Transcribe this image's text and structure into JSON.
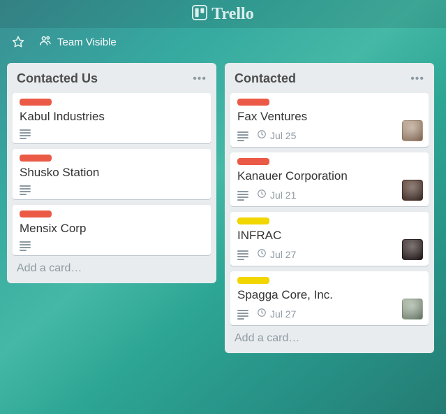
{
  "app": {
    "name": "Trello"
  },
  "board_bar": {
    "visibility_label": "Team Visible"
  },
  "lists": [
    {
      "title": "Contacted Us",
      "add_card_label": "Add a card…",
      "cards": [
        {
          "title": "Kabul Industries",
          "label_color": "red",
          "has_description": true,
          "due": null,
          "has_avatar": false
        },
        {
          "title": "Shusko Station",
          "label_color": "red",
          "has_description": true,
          "due": null,
          "has_avatar": false
        },
        {
          "title": "Mensix Corp",
          "label_color": "red",
          "has_description": true,
          "due": null,
          "has_avatar": false
        }
      ]
    },
    {
      "title": "Contacted",
      "add_card_label": "Add a card…",
      "cards": [
        {
          "title": "Fax Ventures",
          "label_color": "red",
          "has_description": true,
          "due": "Jul 25",
          "has_avatar": true
        },
        {
          "title": "Kanauer Corporation",
          "label_color": "red",
          "has_description": true,
          "due": "Jul 21",
          "has_avatar": true
        },
        {
          "title": "INFRAC",
          "label_color": "yellow",
          "has_description": true,
          "due": "Jul 27",
          "has_avatar": true
        },
        {
          "title": "Spagga Core, Inc.",
          "label_color": "yellow",
          "has_description": true,
          "due": "Jul 27",
          "has_avatar": true
        }
      ]
    }
  ],
  "colors": {
    "red": "#eb5a46",
    "yellow": "#f2d600"
  }
}
